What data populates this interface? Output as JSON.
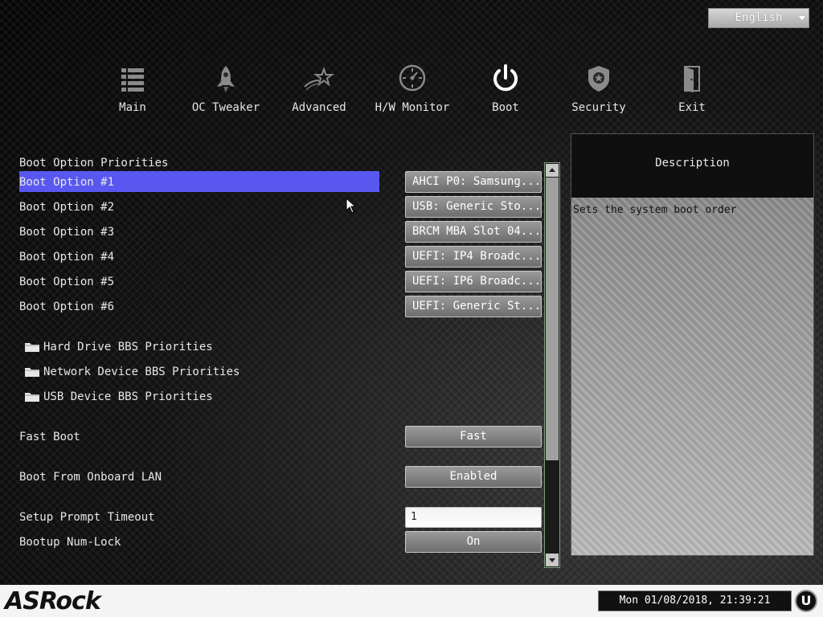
{
  "language": {
    "selected": "English"
  },
  "nav": [
    {
      "label": "Main",
      "icon": "list-icon"
    },
    {
      "label": "OC Tweaker",
      "icon": "rocket-icon"
    },
    {
      "label": "Advanced",
      "icon": "star-icon"
    },
    {
      "label": "H/W Monitor",
      "icon": "gauge-icon"
    },
    {
      "label": "Boot",
      "icon": "power-icon",
      "active": true
    },
    {
      "label": "Security",
      "icon": "shield-icon"
    },
    {
      "label": "Exit",
      "icon": "door-icon"
    }
  ],
  "section_title": "Boot Option Priorities",
  "boot_options": [
    {
      "label": "Boot Option #1",
      "value": "AHCI P0: Samsung..."
    },
    {
      "label": "Boot Option #2",
      "value": "USB: Generic Sto..."
    },
    {
      "label": "Boot Option #3",
      "value": "BRCM MBA Slot 04..."
    },
    {
      "label": "Boot Option #4",
      "value": "UEFI: IP4 Broadc..."
    },
    {
      "label": "Boot Option #5",
      "value": "UEFI: IP6 Broadc..."
    },
    {
      "label": "Boot Option #6",
      "value": "UEFI: Generic St..."
    }
  ],
  "submenus": [
    {
      "label": "Hard Drive BBS Priorities"
    },
    {
      "label": "Network Device BBS Priorities"
    },
    {
      "label": "USB Device BBS Priorities"
    }
  ],
  "settings": {
    "fast_boot": {
      "label": "Fast Boot",
      "value": "Fast"
    },
    "onboard_lan": {
      "label": "Boot From Onboard LAN",
      "value": "Enabled"
    },
    "prompt_timeout": {
      "label": "Setup Prompt Timeout",
      "value": "1"
    },
    "num_lock": {
      "label": "Bootup Num-Lock",
      "value": "On"
    }
  },
  "description": {
    "title": "Description",
    "text": "Sets the system boot order"
  },
  "footer": {
    "brand": "ASRock",
    "datetime": "Mon 01/08/2018, 21:39:21",
    "u_button": "U"
  },
  "colors": {
    "highlight": "#5858f0",
    "active_nav": "#ffffff",
    "inactive_nav_icon": "#8a8a8a"
  }
}
